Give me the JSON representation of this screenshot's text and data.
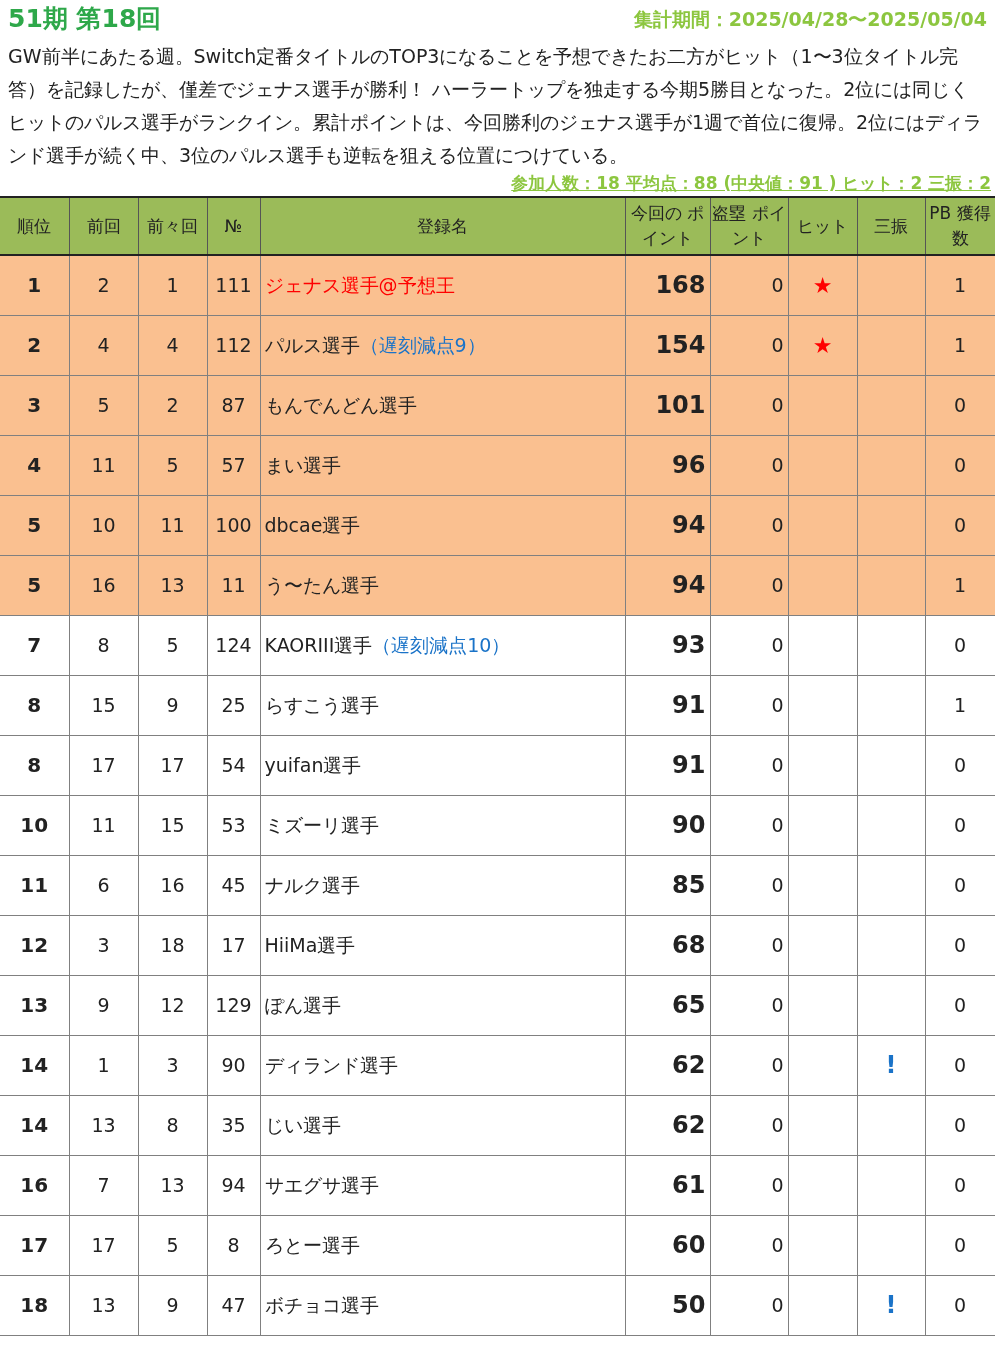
{
  "title": "51期 第18回",
  "period": "集計期間：2025/04/28〜2025/05/04",
  "summary": "GW前半にあたる週。Switch定番タイトルのTOP3になることを予想できたお二方がヒット（1〜3位タイトル完答）を記録したが、僅差でジェナス選手が勝利！ ハーラートップを独走する今期5勝目となった。2位には同じくヒットのパルス選手がランクイン。累計ポイントは、今回勝利のジェナス選手が1週で首位に復帰。2位にはディランド選手が続く中、3位のパルス選手も逆転を狙える位置につけている。",
  "stats": "参加人数：18 平均点：88 (中央値：91 ) ヒット：2 三振：2",
  "columns": [
    "順位",
    "前回",
    "前々回",
    "№",
    "登録名",
    "今回の ポイント",
    "盗塁 ポイント",
    "ヒット",
    "三振",
    "PB 獲得数"
  ],
  "rows": [
    {
      "rank": "1",
      "prev": "2",
      "prev2": "1",
      "no": "111",
      "name": "ジェナス選手@予想王",
      "note": null,
      "winner": true,
      "highlighted": true,
      "points": "168",
      "steal": "0",
      "hit": "★",
      "strikeout": null,
      "pb": "1"
    },
    {
      "rank": "2",
      "prev": "4",
      "prev2": "4",
      "no": "112",
      "name": "パルス選手",
      "note": "（遅刻減点9）",
      "winner": false,
      "highlighted": true,
      "points": "154",
      "steal": "0",
      "hit": "★",
      "strikeout": null,
      "pb": "1"
    },
    {
      "rank": "3",
      "prev": "5",
      "prev2": "2",
      "no": "87",
      "name": "もんでんどん選手",
      "note": null,
      "winner": false,
      "highlighted": true,
      "points": "101",
      "steal": "0",
      "hit": null,
      "strikeout": null,
      "pb": "0"
    },
    {
      "rank": "4",
      "prev": "11",
      "prev2": "5",
      "no": "57",
      "name": "まい選手",
      "note": null,
      "winner": false,
      "highlighted": true,
      "points": "96",
      "steal": "0",
      "hit": null,
      "strikeout": null,
      "pb": "0"
    },
    {
      "rank": "5",
      "prev": "10",
      "prev2": "11",
      "no": "100",
      "name": "dbcae選手",
      "note": null,
      "winner": false,
      "highlighted": true,
      "points": "94",
      "steal": "0",
      "hit": null,
      "strikeout": null,
      "pb": "0"
    },
    {
      "rank": "5",
      "prev": "16",
      "prev2": "13",
      "no": "11",
      "name": "う〜たん選手",
      "note": null,
      "winner": false,
      "highlighted": true,
      "points": "94",
      "steal": "0",
      "hit": null,
      "strikeout": null,
      "pb": "1"
    },
    {
      "rank": "7",
      "prev": "8",
      "prev2": "5",
      "no": "124",
      "name": "KAORIII選手",
      "note": "（遅刻減点10）",
      "winner": false,
      "highlighted": false,
      "points": "93",
      "steal": "0",
      "hit": null,
      "strikeout": null,
      "pb": "0"
    },
    {
      "rank": "8",
      "prev": "15",
      "prev2": "9",
      "no": "25",
      "name": "らすこう選手",
      "note": null,
      "winner": false,
      "highlighted": false,
      "points": "91",
      "steal": "0",
      "hit": null,
      "strikeout": null,
      "pb": "1"
    },
    {
      "rank": "8",
      "prev": "17",
      "prev2": "17",
      "no": "54",
      "name": "yuifan選手",
      "note": null,
      "winner": false,
      "highlighted": false,
      "points": "91",
      "steal": "0",
      "hit": null,
      "strikeout": null,
      "pb": "0"
    },
    {
      "rank": "10",
      "prev": "11",
      "prev2": "15",
      "no": "53",
      "name": "ミズーリ選手",
      "note": null,
      "winner": false,
      "highlighted": false,
      "points": "90",
      "steal": "0",
      "hit": null,
      "strikeout": null,
      "pb": "0"
    },
    {
      "rank": "11",
      "prev": "6",
      "prev2": "16",
      "no": "45",
      "name": "ナルク選手",
      "note": null,
      "winner": false,
      "highlighted": false,
      "points": "85",
      "steal": "0",
      "hit": null,
      "strikeout": null,
      "pb": "0"
    },
    {
      "rank": "12",
      "prev": "3",
      "prev2": "18",
      "no": "17",
      "name": "HiiMa選手",
      "note": null,
      "winner": false,
      "highlighted": false,
      "points": "68",
      "steal": "0",
      "hit": null,
      "strikeout": null,
      "pb": "0"
    },
    {
      "rank": "13",
      "prev": "9",
      "prev2": "12",
      "no": "129",
      "name": "ぽん選手",
      "note": null,
      "winner": false,
      "highlighted": false,
      "points": "65",
      "steal": "0",
      "hit": null,
      "strikeout": null,
      "pb": "0"
    },
    {
      "rank": "14",
      "prev": "1",
      "prev2": "3",
      "no": "90",
      "name": "ディランド選手",
      "note": null,
      "winner": false,
      "highlighted": false,
      "points": "62",
      "steal": "0",
      "hit": null,
      "strikeout": "!",
      "pb": "0"
    },
    {
      "rank": "14",
      "prev": "13",
      "prev2": "8",
      "no": "35",
      "name": "じい選手",
      "note": null,
      "winner": false,
      "highlighted": false,
      "points": "62",
      "steal": "0",
      "hit": null,
      "strikeout": null,
      "pb": "0"
    },
    {
      "rank": "16",
      "prev": "7",
      "prev2": "13",
      "no": "94",
      "name": "サエグサ選手",
      "note": null,
      "winner": false,
      "highlighted": false,
      "points": "61",
      "steal": "0",
      "hit": null,
      "strikeout": null,
      "pb": "0"
    },
    {
      "rank": "17",
      "prev": "17",
      "prev2": "5",
      "no": "8",
      "name": "ろとー選手",
      "note": null,
      "winner": false,
      "highlighted": false,
      "points": "60",
      "steal": "0",
      "hit": null,
      "strikeout": null,
      "pb": "0"
    },
    {
      "rank": "18",
      "prev": "13",
      "prev2": "9",
      "no": "47",
      "name": "ボチョコ選手",
      "note": null,
      "winner": false,
      "highlighted": false,
      "points": "50",
      "steal": "0",
      "hit": null,
      "strikeout": "!",
      "pb": "0"
    }
  ]
}
